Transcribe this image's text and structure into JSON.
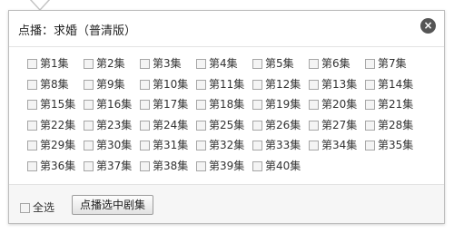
{
  "dialog": {
    "title": "点播：求婚（普清版）",
    "close_icon": "close-circle-icon"
  },
  "episodes": [
    [
      "第1集",
      "第2集",
      "第3集",
      "第4集",
      "第5集",
      "第6集",
      "第7集"
    ],
    [
      "第8集",
      "第9集",
      "第10集",
      "第11集",
      "第12集",
      "第13集",
      "第14集"
    ],
    [
      "第15集",
      "第16集",
      "第17集",
      "第18集",
      "第19集",
      "第20集",
      "第21集"
    ],
    [
      "第22集",
      "第23集",
      "第24集",
      "第25集",
      "第26集",
      "第27集",
      "第28集"
    ],
    [
      "第29集",
      "第30集",
      "第31集",
      "第32集",
      "第33集",
      "第34集",
      "第35集"
    ],
    [
      "第36集",
      "第37集",
      "第38集",
      "第39集",
      "第40集"
    ]
  ],
  "footer": {
    "select_all_label": "全选",
    "play_selected_label": "点播选中剧集"
  }
}
